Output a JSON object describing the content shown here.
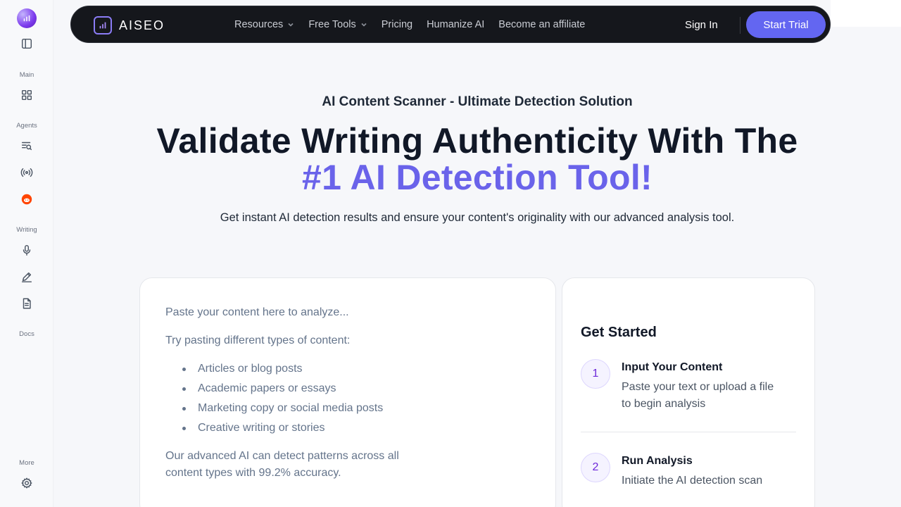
{
  "sidebar": {
    "sections": {
      "main": "Main",
      "agents": "Agents",
      "writing": "Writing",
      "docs": "Docs",
      "more": "More"
    }
  },
  "nav": {
    "brand": "AISEO",
    "links": [
      "Resources",
      "Free Tools",
      "Pricing",
      "Humanize AI",
      "Become an affiliate"
    ],
    "sign_in": "Sign In",
    "start_trial": "Start Trial"
  },
  "hero": {
    "eyebrow": "AI Content Scanner - Ultimate Detection Solution",
    "title_line1": "Validate Writing Authenticity With The",
    "title_line2": "#1 AI Detection Tool!",
    "subtitle": "Get instant AI detection results and ensure your content's originality with our advanced analysis tool."
  },
  "editor": {
    "placeholder_line1": "Paste your content here to analyze...",
    "placeholder_line2": "Try pasting different types of content:",
    "bullets": [
      "Articles or blog posts",
      "Academic papers or essays",
      "Marketing copy or social media posts",
      "Creative writing or stories"
    ],
    "closing_line1": "Our advanced AI can detect patterns across all",
    "closing_line2": "content types with 99.2% accuracy."
  },
  "guide": {
    "title": "Get Started",
    "steps": [
      {
        "num": "1",
        "title": "Input Your Content",
        "desc": "Paste your text or upload a file to begin analysis"
      },
      {
        "num": "2",
        "title": "Run Analysis",
        "desc": "Initiate the AI detection scan"
      }
    ]
  },
  "colors": {
    "accent": "#6366f1",
    "title_accent": "#6a63ea",
    "nav_bg": "#15171c"
  }
}
